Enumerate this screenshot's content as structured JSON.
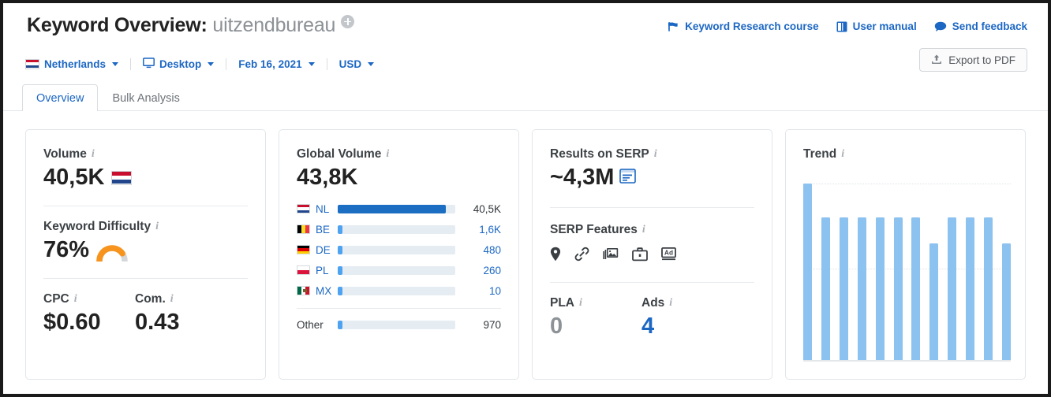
{
  "header": {
    "title_prefix": "Keyword Overview:",
    "keyword": "uitzendbureau",
    "add_icon": "plus-circle-icon",
    "links": [
      {
        "label": "Keyword Research course",
        "icon": "graduation-flag-icon"
      },
      {
        "label": "User manual",
        "icon": "book-icon"
      },
      {
        "label": "Send feedback",
        "icon": "chat-bubble-icon"
      }
    ],
    "export_button": {
      "label": "Export to PDF",
      "icon": "upload-icon"
    }
  },
  "filters": [
    {
      "label": "Netherlands",
      "icon": "flag-nl-icon",
      "caret": true
    },
    {
      "label": "Desktop",
      "icon": "monitor-icon",
      "caret": true
    },
    {
      "label": "Feb 16, 2021",
      "icon": "",
      "caret": true
    },
    {
      "label": "USD",
      "icon": "",
      "caret": true
    }
  ],
  "tabs": [
    {
      "label": "Overview",
      "active": true
    },
    {
      "label": "Bulk Analysis",
      "active": false
    }
  ],
  "cards": {
    "volume": {
      "label": "Volume",
      "value": "40,5K",
      "flag": "flag-nl-icon",
      "keyword_difficulty": {
        "label": "Keyword Difficulty",
        "value": "76%",
        "percent": 76,
        "gauge_color": "#f7941d",
        "gauge_track": "#d5d8db"
      },
      "cpc": {
        "label": "CPC",
        "value": "$0.60"
      },
      "com": {
        "label": "Com.",
        "value": "0.43"
      }
    },
    "global_volume": {
      "label": "Global Volume",
      "value": "43,8K",
      "other": {
        "label": "Other",
        "value": "970",
        "percent": 4
      }
    },
    "serp": {
      "label": "Results on SERP",
      "value": "~4,3M",
      "value_icon": "serp-snippet-icon",
      "features_label": "SERP Features",
      "features": [
        {
          "name": "local-pack-icon"
        },
        {
          "name": "sitelinks-icon"
        },
        {
          "name": "image-pack-icon"
        },
        {
          "name": "jobs-icon"
        },
        {
          "name": "ads-top-icon"
        }
      ],
      "pla": {
        "label": "PLA",
        "value": "0"
      },
      "ads": {
        "label": "Ads",
        "value": "4"
      }
    },
    "trend": {
      "label": "Trend"
    }
  },
  "colors": {
    "link_blue": "#1c67c4",
    "bar_blue": "#1b6ec2",
    "bar_light": "#4da3f0",
    "trend_blue": "#8cc2ef",
    "orange": "#f7941d"
  },
  "chart_data": [
    {
      "type": "bar",
      "title": "Global Volume",
      "orientation": "horizontal",
      "categories": [
        "NL",
        "BE",
        "DE",
        "PL",
        "MX",
        "Other"
      ],
      "value_labels": [
        "40,5K",
        "1,6K",
        "480",
        "260",
        "10",
        "970"
      ],
      "values": [
        40500,
        1600,
        480,
        260,
        10,
        970
      ],
      "bar_fill_percent": [
        92,
        4,
        4,
        4,
        4,
        4
      ],
      "total": 43800,
      "total_label": "43,8K",
      "xlabel": "",
      "ylabel": "",
      "grid": false,
      "legend": false
    },
    {
      "type": "bar",
      "title": "Trend",
      "categories": [
        "1",
        "2",
        "3",
        "4",
        "5",
        "6",
        "7",
        "8",
        "9",
        "10",
        "11",
        "12"
      ],
      "values": [
        1.0,
        0.81,
        0.81,
        0.81,
        0.81,
        0.81,
        0.81,
        0.66,
        0.81,
        0.81,
        0.81,
        0.66
      ],
      "ylim": [
        0,
        1.0
      ],
      "xlabel": "",
      "ylabel": "",
      "grid": true,
      "legend": false
    }
  ]
}
